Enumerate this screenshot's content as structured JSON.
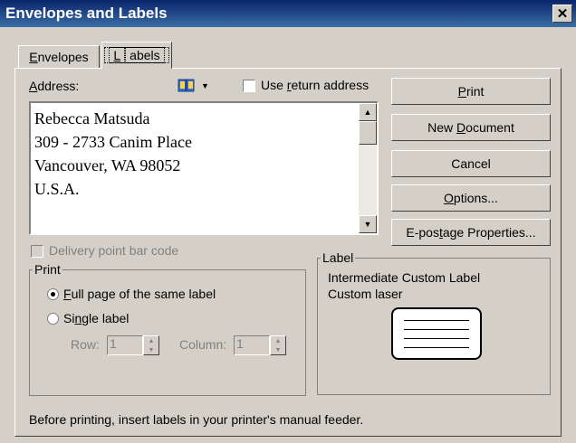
{
  "window": {
    "title": "Envelopes and Labels",
    "close_glyph": "✕"
  },
  "tabs": [
    {
      "label_pre": "",
      "label_u": "E",
      "label_post": "nvelopes"
    },
    {
      "label_pre": "",
      "label_u": "L",
      "label_post": "abels"
    }
  ],
  "address": {
    "label_pre": "",
    "label_u": "A",
    "label_post": "ddress:",
    "book_icon": "address-book-icon",
    "use_return_pre": "Use ",
    "use_return_u": "r",
    "use_return_post": "eturn address",
    "lines": [
      "Rebecca Matsuda",
      "309 - 2733 Canim Place",
      "Vancouver, WA 98052",
      "U.S.A."
    ]
  },
  "buttons": {
    "print_pre": "",
    "print_u": "P",
    "print_post": "rint",
    "new_doc_pre": "New ",
    "new_doc_u": "D",
    "new_doc_post": "ocument",
    "cancel": "Cancel",
    "options_pre": "",
    "options_u": "O",
    "options_post": "ptions...",
    "epostage_pre": "E-pos",
    "epostage_u": "t",
    "epostage_post": "age Properties..."
  },
  "delivery_barcode": "Delivery point bar code",
  "print_group": {
    "title": "Print",
    "full_page_pre": "",
    "full_page_u": "F",
    "full_page_post": "ull page of the same label",
    "single_pre": "Si",
    "single_u": "n",
    "single_post": "gle label",
    "row_label": "Row:",
    "row_value": "1",
    "column_label": "Column:",
    "column_value": "1"
  },
  "label_group": {
    "title": "Label",
    "line1": "Intermediate Custom Label",
    "line2": "Custom laser"
  },
  "footer": "Before printing, insert labels in your printer's manual feeder."
}
